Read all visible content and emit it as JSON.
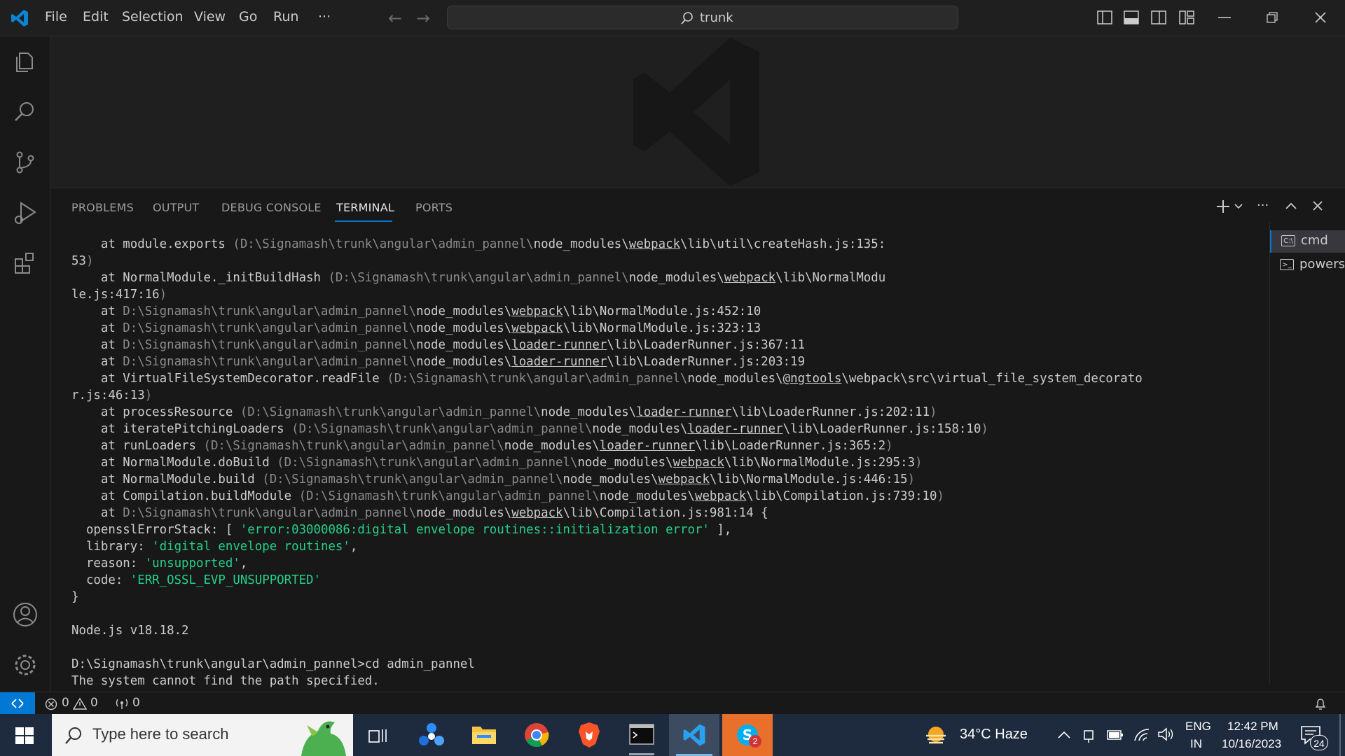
{
  "menu": {
    "file": "File",
    "edit": "Edit",
    "selection": "Selection",
    "view": "View",
    "go": "Go",
    "run": "Run",
    "more": "···"
  },
  "command_center": {
    "label": "trunk"
  },
  "panel": {
    "tabs": {
      "problems": "PROBLEMS",
      "output": "OUTPUT",
      "debug": "DEBUG CONSOLE",
      "terminal": "TERMINAL",
      "ports": "PORTS"
    },
    "terminals": [
      "cmd",
      "powershell"
    ]
  },
  "terminal": {
    "l1a": "    at module.exports ",
    "l1b": "(D:\\Signamash\\trunk\\angular\\admin_pannel\\",
    "l1c": "node_modules\\",
    "l1d": "webpack",
    "l1e": "\\lib\\util\\createHash.js:135:",
    "l2a": "53",
    "l2b": ")",
    "l3a": "    at NormalModule._initBuildHash ",
    "l3b": "(D:\\Signamash\\trunk\\angular\\admin_pannel\\",
    "l3c": "node_modules\\",
    "l3d": "webpack",
    "l3e": "\\lib\\NormalModu",
    "l4a": "le.js:417:16",
    "l4b": ")",
    "l5a": "    at ",
    "l5b": "D:\\Signamash\\trunk\\angular\\admin_pannel\\",
    "l5c": "node_modules\\",
    "l5d": "webpack",
    "l5e": "\\lib\\NormalModule.js:452:10",
    "l6a": "    at ",
    "l6b": "D:\\Signamash\\trunk\\angular\\admin_pannel\\",
    "l6c": "node_modules\\",
    "l6d": "webpack",
    "l6e": "\\lib\\NormalModule.js:323:13",
    "l7a": "    at ",
    "l7b": "D:\\Signamash\\trunk\\angular\\admin_pannel\\",
    "l7c": "node_modules\\",
    "l7d": "loader-runner",
    "l7e": "\\lib\\LoaderRunner.js:367:11",
    "l8a": "    at ",
    "l8b": "D:\\Signamash\\trunk\\angular\\admin_pannel\\",
    "l8c": "node_modules\\",
    "l8d": "loader-runner",
    "l8e": "\\lib\\LoaderRunner.js:203:19",
    "l9a": "    at VirtualFileSystemDecorator.readFile ",
    "l9b": "(D:\\Signamash\\trunk\\angular\\admin_pannel\\",
    "l9c": "node_modules\\",
    "l9d": "@ngtools",
    "l9e": "\\webpack\\src\\virtual_file_system_decorato",
    "l10a": "r.js:46:13",
    "l10b": ")",
    "l11a": "    at processResource ",
    "l11b": "(D:\\Signamash\\trunk\\angular\\admin_pannel\\",
    "l11c": "node_modules\\",
    "l11d": "loader-runner",
    "l11e": "\\lib\\LoaderRunner.js:202:11",
    "l11f": ")",
    "l12a": "    at iteratePitchingLoaders ",
    "l12b": "(D:\\Signamash\\trunk\\angular\\admin_pannel\\",
    "l12c": "node_modules\\",
    "l12d": "loader-runner",
    "l12e": "\\lib\\LoaderRunner.js:158:10",
    "l12f": ")",
    "l13a": "    at runLoaders ",
    "l13b": "(D:\\Signamash\\trunk\\angular\\admin_pannel\\",
    "l13c": "node_modules\\",
    "l13d": "loader-runner",
    "l13e": "\\lib\\LoaderRunner.js:365:2",
    "l13f": ")",
    "l14a": "    at NormalModule.doBuild ",
    "l14b": "(D:\\Signamash\\trunk\\angular\\admin_pannel\\",
    "l14c": "node_modules\\",
    "l14d": "webpack",
    "l14e": "\\lib\\NormalModule.js:295:3",
    "l14f": ")",
    "l15a": "    at NormalModule.build ",
    "l15b": "(D:\\Signamash\\trunk\\angular\\admin_pannel\\",
    "l15c": "node_modules\\",
    "l15d": "webpack",
    "l15e": "\\lib\\NormalModule.js:446:15",
    "l15f": ")",
    "l16a": "    at Compilation.buildModule ",
    "l16b": "(D:\\Signamash\\trunk\\angular\\admin_pannel\\",
    "l16c": "node_modules\\",
    "l16d": "webpack",
    "l16e": "\\lib\\Compilation.js:739:10",
    "l16f": ")",
    "l17a": "    at ",
    "l17b": "D:\\Signamash\\trunk\\angular\\admin_pannel\\",
    "l17c": "node_modules\\",
    "l17d": "webpack",
    "l17e": "\\lib\\Compilation.js:981:14 {",
    "l18a": "  opensslErrorStack: [ ",
    "l18b": "'error:03000086:digital envelope routines::initialization error'",
    "l18c": " ],",
    "l19a": "  library: ",
    "l19b": "'digital envelope routines'",
    "l19c": ",",
    "l20a": "  reason: ",
    "l20b": "'unsupported'",
    "l20c": ",",
    "l21a": "  code: ",
    "l21b": "'ERR_OSSL_EVP_UNSUPPORTED'",
    "l22": "}",
    "l23": "",
    "l24": "Node.js v18.18.2",
    "l25": "",
    "l26": "D:\\Signamash\\trunk\\angular\\admin_pannel>cd admin_pannel",
    "l27": "The system cannot find the path specified."
  },
  "status": {
    "errors": "0",
    "warnings": "0",
    "ports": "0"
  },
  "taskbar": {
    "search_placeholder": "Type here to search",
    "weather": "34°C  Haze",
    "lang1": "ENG",
    "lang2": "IN",
    "time": "12:42 PM",
    "date": "10/16/2023",
    "notif_count": "24",
    "skype_badge": "2"
  }
}
